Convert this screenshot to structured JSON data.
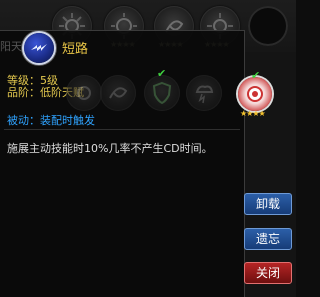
{
  "skill": {
    "name": "短路",
    "level_label": "等级：",
    "level_value": "5级",
    "rank_label": "品阶：",
    "rank_value": "低阶天赋",
    "passive_label": "被动：",
    "passive_value": "装配时触发",
    "description": "施展主动技能时10%几率不产生CD时间。"
  },
  "background": {
    "tab_label": "阳天赋",
    "star_text": "★★★★"
  },
  "buttons": {
    "unequip": "卸载",
    "forget": "遗忘",
    "close": "关闭"
  },
  "colors": {
    "accent_yellow": "#e3c84e",
    "accent_blue": "#2fa3ff",
    "button_blue": "#2c5fa8",
    "button_red": "#b52525"
  }
}
